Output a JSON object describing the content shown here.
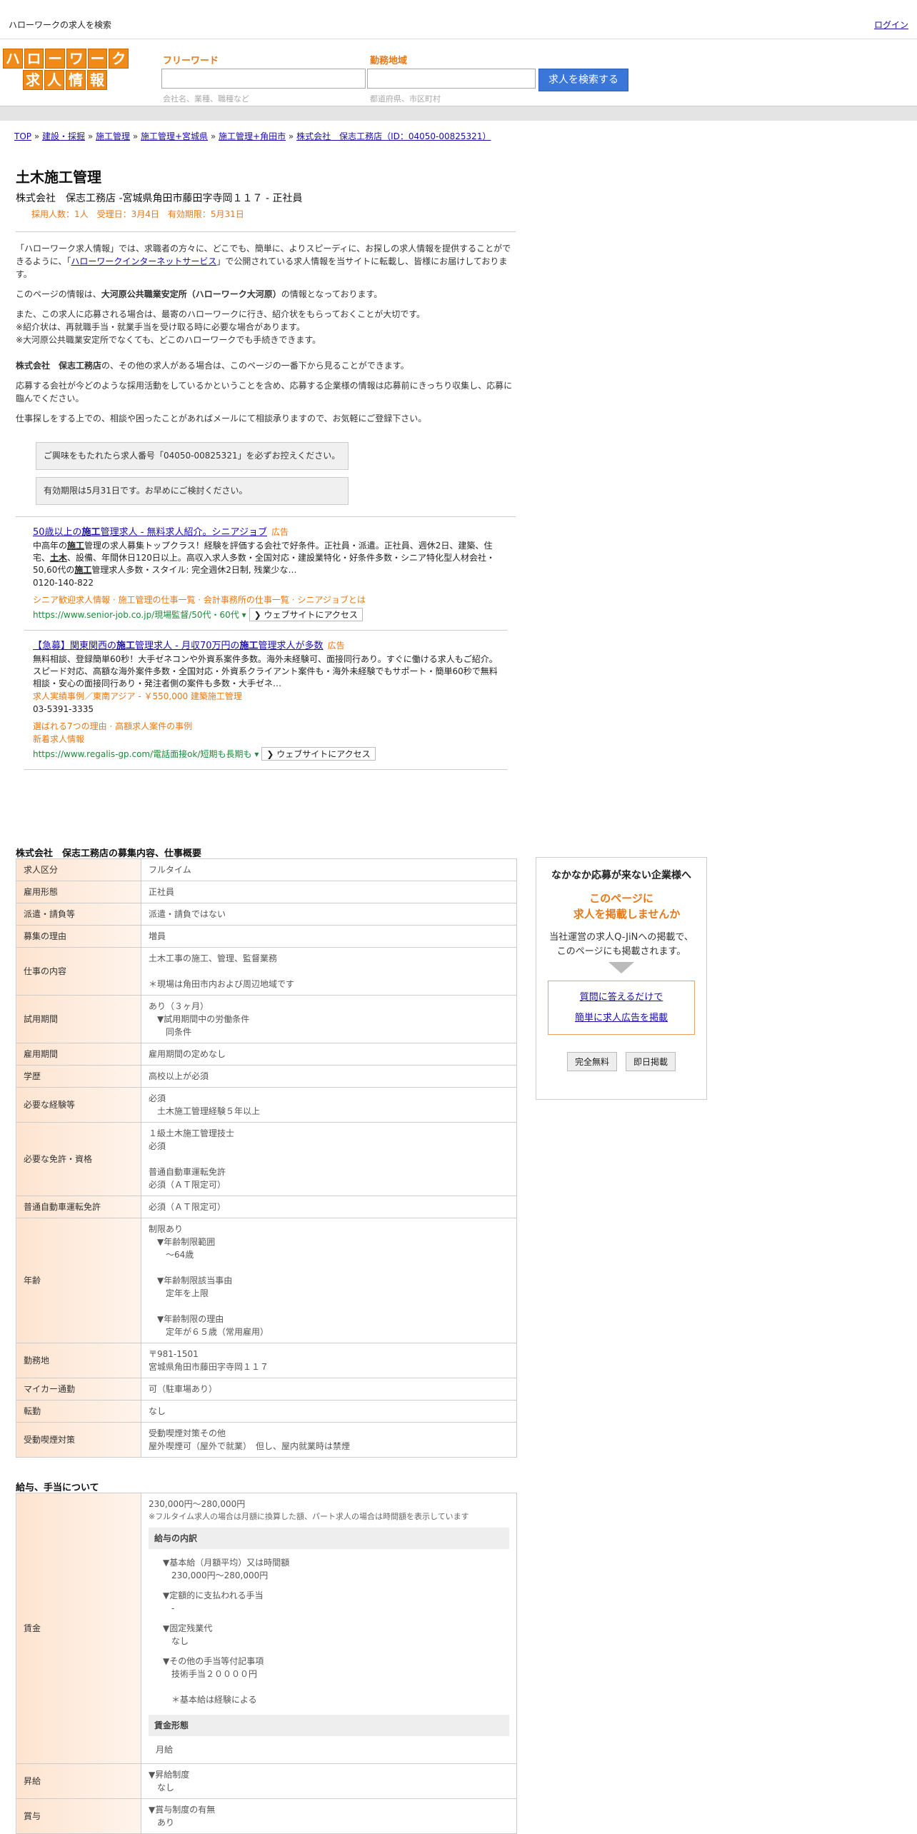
{
  "header": {
    "site_title": "ハローワークの求人を検索",
    "login": "ログイン",
    "logo_row1": [
      "ハ",
      "ロ",
      "ー",
      "ワ",
      "ー",
      "ク"
    ],
    "logo_row2": [
      "求",
      "人",
      "情",
      "報"
    ]
  },
  "search": {
    "freeword_label": "フリーワード",
    "freeword_hint": "会社名、業種、職種など",
    "area_label": "勤務地域",
    "area_hint": "都道府県、市区町村",
    "button": "求人を検索する"
  },
  "breadcrumb": {
    "items": [
      "TOP",
      "建設・採掘",
      "施工管理",
      "施工管理+宮城県",
      "施工管理+角田市",
      "株式会社　保志工務店（ID：04050-00825321）"
    ],
    "sep": " » "
  },
  "job": {
    "title": "土木施工管理",
    "company_line": "株式会社　保志工務店 -宮城県角田市藤田字寺岡１１７ - 正社員",
    "meta": "採用人数：1人　受理日：3月4日　有効期限：5月31日"
  },
  "intro": {
    "p1_a": "「ハローワーク求人情報」では、求職者の方々に、どこでも、簡単に、よりスピーディに、お探しの求人情報を提供することができるように、「",
    "p1_link": "ハローワークインターネットサービス",
    "p1_b": "」で公開されている求人情報を当サイトに転載し、皆様にお届けしております。",
    "p2_a": "このページの情報は、",
    "p2_bold": "大河原公共職業安定所（ハローワーク大河原）",
    "p2_b": "の情報となっております。",
    "p3_l1": "また、この求人に応募される場合は、最寄のハローワークに行き、紹介状をもらっておくことが大切です。",
    "p3_l2": "※紹介状は、再就職手当・就業手当を受け取る時に必要な場合があります。",
    "p3_l3": "※大河原公共職業安定所でなくても、どこのハローワークでも手続きできます。",
    "p4_bold": "株式会社　保志工務店",
    "p4_b": "の、その他の求人がある場合は、このページの一番下から見ることができます。",
    "p5": "応募する会社が今どのような採用活動をしているかということを含め、応募する企業様の情報は応募前にきっちり収集し、応募に臨んでください。",
    "p6": "仕事探しをする上での、相談や困ったことがあればメールにて相談承りますので、お気軽にご登録下さい。",
    "box1": "ご興味をもたれたら求人番号「04050-00825321」を必ずお控えください。",
    "box2": "有効期限は5月31日です。お早めにご検討ください。"
  },
  "ads": [
    {
      "title": "50歳以上の施工管理求人 - 無料求人紹介。シニアジョブ",
      "tag": "広告",
      "desc": "中高年の施工管理の求人募集トップクラス！経験を評価する会社で好条件。正社員・派遣。正社員、週休2日、建築、住宅、土木、設備、年間休日120日以上。高収入求人多数・全国対応・建設業特化・好条件多数・シニア特化型人材会社・50,60代の施工管理求人多数・スタイル: 完全週休2日制, 残業少な…",
      "phone": "0120-140-822",
      "sitelinks": "シニア歓迎求人情報 · 施工管理の仕事一覧 · 会計事務所の仕事一覧 · シニアジョブとは",
      "url": "https://www.senior-job.co.jp/現場監督/50代・60代 ▾",
      "visit": "❯ ウェブサイトにアクセス"
    },
    {
      "title": "【急募】関東関西の施工管理求人 - 月収70万円の施工管理求人が多数",
      "tag": "広告",
      "desc": "無料相談、登録簡単60秒！大手ゼネコンや外資系案件多数。海外未経験可、面接同行あり。すぐに働ける求人もご紹介。スピード対応、高額な海外案件多数・全国対応・外資系クライアント案件も・海外未経験でもサポート・簡単60秒で無料相談・安心の面接同行あり・発注者側の案件も多数・大手ゼネ…",
      "extra": "求人実績事例／東南アジア - ￥550,000 建築施工管理",
      "phone": "03-5391-3335",
      "sitelinks": "選ばれる7つの理由 · 高額求人案件の事例\n新着求人情報",
      "url": "https://www.regalis-gp.com/電話面接ok/短期も長期も ▾",
      "visit": "❯ ウェブサイトにアクセス"
    }
  ],
  "overview": {
    "heading": "株式会社　保志工務店の募集内容、仕事概要",
    "rows": [
      {
        "label": "求人区分",
        "value": "フルタイム"
      },
      {
        "label": "雇用形態",
        "value": "正社員"
      },
      {
        "label": "派遣・請負等",
        "value": "派遣・請負ではない"
      },
      {
        "label": "募集の理由",
        "value": "増員"
      },
      {
        "label": "仕事の内容",
        "value": "土木工事の施工、管理、監督業務\n\n＊現場は角田市内および周辺地域です"
      },
      {
        "label": "試用期間",
        "value": "あり（３ヶ月）\n　▼試用期間中の労働条件\n　　同条件"
      },
      {
        "label": "雇用期間",
        "value": "雇用期間の定めなし"
      },
      {
        "label": "学歴",
        "value": "高校以上が必須"
      },
      {
        "label": "必要な経験等",
        "value": "必須\n　土木施工管理経験５年以上"
      },
      {
        "label": "必要な免許・資格",
        "value": "１級土木施工管理技士\n必須\n\n普通自動車運転免許\n必須（ＡＴ限定可）"
      },
      {
        "label": "普通自動車運転免許",
        "value": "必須（ＡＴ限定可）"
      },
      {
        "label": "年齢",
        "value": "制限あり\n　▼年齢制限範囲\n　　～64歳\n\n　▼年齢制限該当事由\n　　定年を上限\n\n　▼年齢制限の理由\n　　定年が６５歳（常用雇用）"
      },
      {
        "label": "勤務地",
        "value": "〒981-1501\n宮城県角田市藤田字寺岡１１７"
      },
      {
        "label": "マイカー通勤",
        "value": "可（駐車場あり）"
      },
      {
        "label": "転勤",
        "value": "なし"
      },
      {
        "label": "受動喫煙対策",
        "value": "受動喫煙対策その他\n屋外喫煙可（屋外で就業）　但し、屋内就業時は禁煙"
      }
    ]
  },
  "salary": {
    "heading": "給与、手当について",
    "wage_label": "賃金",
    "wage_range": "230,000円〜280,000円",
    "wage_note": "※フルタイム求人の場合は月額に換算した額、パート求人の場合は時間額を表示しています",
    "breakdown_head": "給与の内訳",
    "items": [
      "▼基本給（月額平均）又は時間額\n　230,000円〜280,000円",
      "▼定額的に支払われる手当\n　-",
      "▼固定残業代\n　なし",
      "▼その他の手当等付記事項\n　技術手当２００００円\n\n　＊基本給は経験による"
    ],
    "form_head": "賃金形態",
    "form_value": "月給",
    "raise_label": "昇給",
    "raise_value": "▼昇給制度\n　なし",
    "bonus_label": "賞与",
    "bonus_value": "▼賞与制度の有無\n　あり"
  },
  "sidebar": {
    "head": "なかなか応募が来ない企業様へ",
    "orange": "このページに\n　求人を掲載しませんか",
    "body": "当社運営の求人Q-JiNへの掲載で、\nこのページにも掲載されます。",
    "link1": "質問に答えるだけで",
    "link2": "簡単に求人広告を掲載",
    "btn1": "完全無料",
    "btn2": "即日掲載"
  }
}
